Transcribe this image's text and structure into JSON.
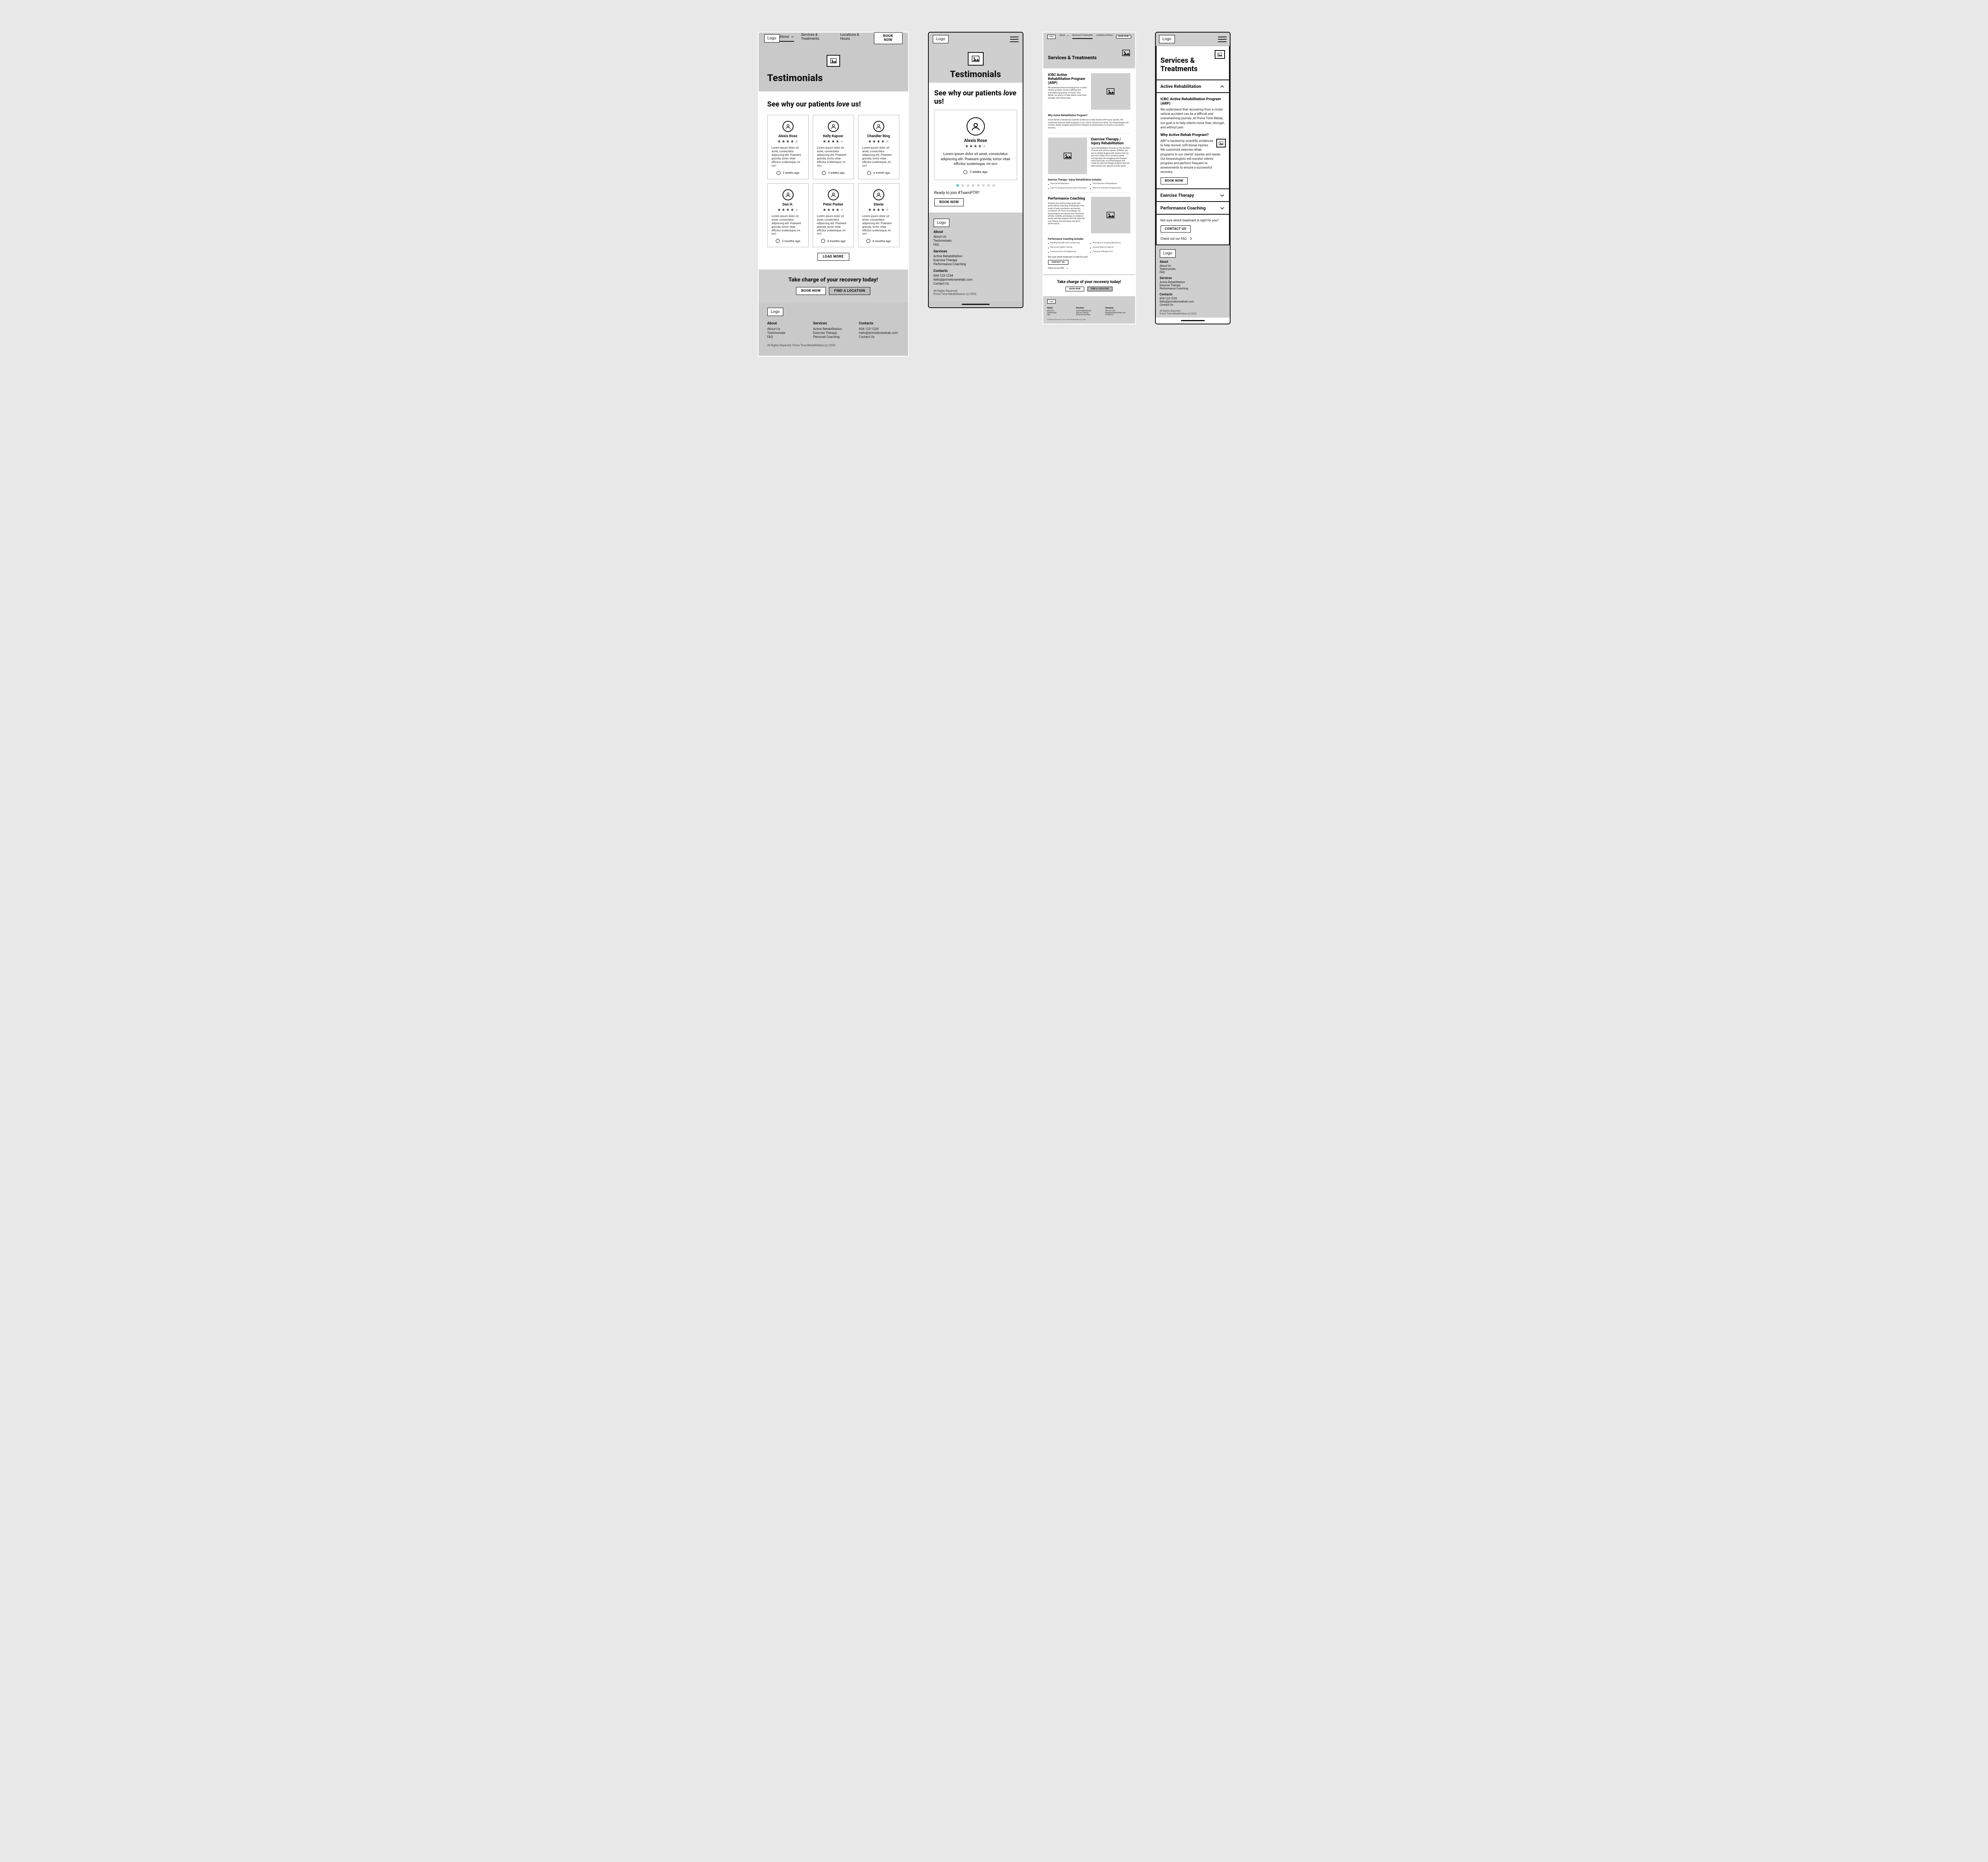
{
  "brand": {
    "logo_label": "Logo"
  },
  "nav": {
    "items": [
      {
        "label": "About",
        "has_chevron": true,
        "active": true
      },
      {
        "label": "Services & Treatments"
      },
      {
        "label": "Locations & Hours"
      }
    ],
    "book_now": "BOOK NOW"
  },
  "testimonials": {
    "title": "Testimonials",
    "subhead_before": "See why our patients ",
    "subhead_em": "love",
    "subhead_after": " us!",
    "load_more": "LOAD MORE",
    "cards": [
      {
        "name": "Alexis Rose",
        "stars": 4,
        "time": "2 weeks ago",
        "text": "Lorem ipsum dolor sit amet, consectetur adipiscing elit. Praesent gravida, tortor vitae efficitur scelerisque, mi orci"
      },
      {
        "name": "Kelly Kapoor",
        "stars": 4,
        "time": "3 weeks ago",
        "text": "Lorem ipsum dolor sit amet, consectetur adipiscing elit. Praesent gravida, tortor vitae efficitur scelerisque, mi orci"
      },
      {
        "name": "Chandler Bing",
        "stars": 4,
        "time": "a month ago",
        "text": "Lorem ipsum dolor sit amet, consectetur adipiscing elit. Praesent gravida, tortor vitae efficitur scelerisque, mi orci"
      },
      {
        "name": "Dan H.",
        "stars": 4,
        "time": "3 months ago",
        "text": "Lorem ipsum dolor sit amet, consectetur adipiscing elit. Praesent gravida, tortor vitae efficitur scelerisque, mi orci"
      },
      {
        "name": "Peter Parker",
        "stars": 4,
        "time": "4 months ago",
        "text": "Lorem ipsum dolor sit amet, consectetur adipiscing elit. Praesent gravida, tortor vitae efficitur scelerisque, mi orci"
      },
      {
        "name": "Stevie",
        "stars": 4,
        "time": "6 months ago",
        "text": "Lorem ipsum dolor sit amet, consectetur adipiscing elit. Praesent gravida, tortor vitae efficitur scelerisque, mi orci"
      }
    ],
    "cta_title": "Take charge of your recovery today!",
    "cta_book": "BOOK NOW",
    "cta_find": "FIND A LOCATION",
    "mobile_join": "Ready to join #TeamPTR?"
  },
  "services": {
    "title": "Services & Treatments",
    "arp_title": "ICBC Active Rehabilitation Program (ARP)",
    "arp_intro": "We understand that recovering from a motor vehicle accident can be a difficult and overwhelming journey. At Prime Time Rehab, our goal is to help clients move freer, stronger, and without pain.",
    "arp_intro_prefix": "We understand that recovering from a motor vehicle accident can be a difficult and overwhelming journey. At Prime Time Rehab, our goal is to help clients move ",
    "arp_intro_em1": "freer, stronger",
    "arp_intro_mid": ", and ",
    "arp_intro_em2": "without pain",
    "arp_intro_suffix": ".",
    "arp_q": "Why Active Rehabilitation Program?",
    "arp_q_short": "Why Active Rehab Program?",
    "arp_q_text": "Active Rehab is backed by scientific evidences to help recover with tissue injuries. We customize exercise rehab programs to our clients' injuries and needs. Our kinesiologists will monitor clients' progress and perform frequent re-assessments to ensure a successful recovery.",
    "arp_q_text_mobile": "ARP is backed by scientific evidences to help recover soft-tissue injuries. We customize exercise rehab programs to our clients' injuries and needs. Our kinesiologists will monitor clients' progress and perform frequent re-assessments to ensure a successful recovery.",
    "ex_title": "Exercise Therapy / Injury Rehabilitation",
    "ex_intro": "Injury Rehabilitation focuses on the recovery of acute and chronic injuries. Whether you are an athlete dealing with injuries that you just can't shake off or someone going through daily life struggling with frequent lower-back pain, our kinesiologists will create an exercise therapy program that will help achieve your specific activity goals.",
    "ex_includes_title": "Exercise Therapy / Injury Rehabilitation includes:",
    "ex_includes": [
      "Physical Rehabilitation",
      "Post-Operation Rehabilitation",
      "Exercise Programming for Injury Prevention",
      "Return-to-Activities Programming"
    ],
    "pc_title": "Performance Coaching",
    "pc_intro": "Achieve your performance goals with performance coaching. Kinesiology is the study of body mechanics and human movement. At Prime Time Rehab, our kinesiologists will assess your functional athletic mobility and design an evidence-based exercise program that will optimize your fitness, biomechanics and sport performance.",
    "pc_includes_title": "Performance Coaching includes:",
    "pc_includes": [
      "Building Strength and Conditioning",
      "Running and Jumping Mechanics",
      "Speed and Agility Training",
      "Gradual Return-to-Sports",
      "Functional Core Strengthening",
      "Toning and Weight Loss"
    ],
    "help_text": "Not sure which treatment is right for you?",
    "contact_us": "CONTACT US",
    "faq_label": "Check out our FAQ",
    "accordion": [
      {
        "label": "Active Rehabilitation",
        "open": true
      },
      {
        "label": "Exercise Therapy",
        "open": false
      },
      {
        "label": "Performance Coaching",
        "open": false
      }
    ],
    "book_now": "BOOK NOW",
    "cta_title": "Take charge of your recovery today!",
    "cta_book": "BOOK NOW",
    "cta_find": "FIND A LOCATION"
  },
  "footer": {
    "about": {
      "heading": "About",
      "items": [
        "About Us",
        "Testimonials",
        "FAQ"
      ]
    },
    "services": {
      "heading": "Services",
      "items": [
        "Active Rehabilitation",
        "Exercise Therapy",
        "Personal Coaching"
      ]
    },
    "services_mobile": {
      "heading": "Services",
      "items": [
        "Active Rehabilitation",
        "Exercise Therapy",
        "Performance Coaching"
      ]
    },
    "contacts": {
      "heading": "Contacts",
      "phone": "604-123-1234",
      "email": "hello@primetimerehab.com",
      "contact_us": "Contact Us"
    },
    "legal_1": "All Rights Reserved. Prime Time Rehabilitation (c) 2020",
    "legal_2a": "All Rights Reserved.",
    "legal_2b": "Prime Time Rehabilitation (c) 2020."
  }
}
